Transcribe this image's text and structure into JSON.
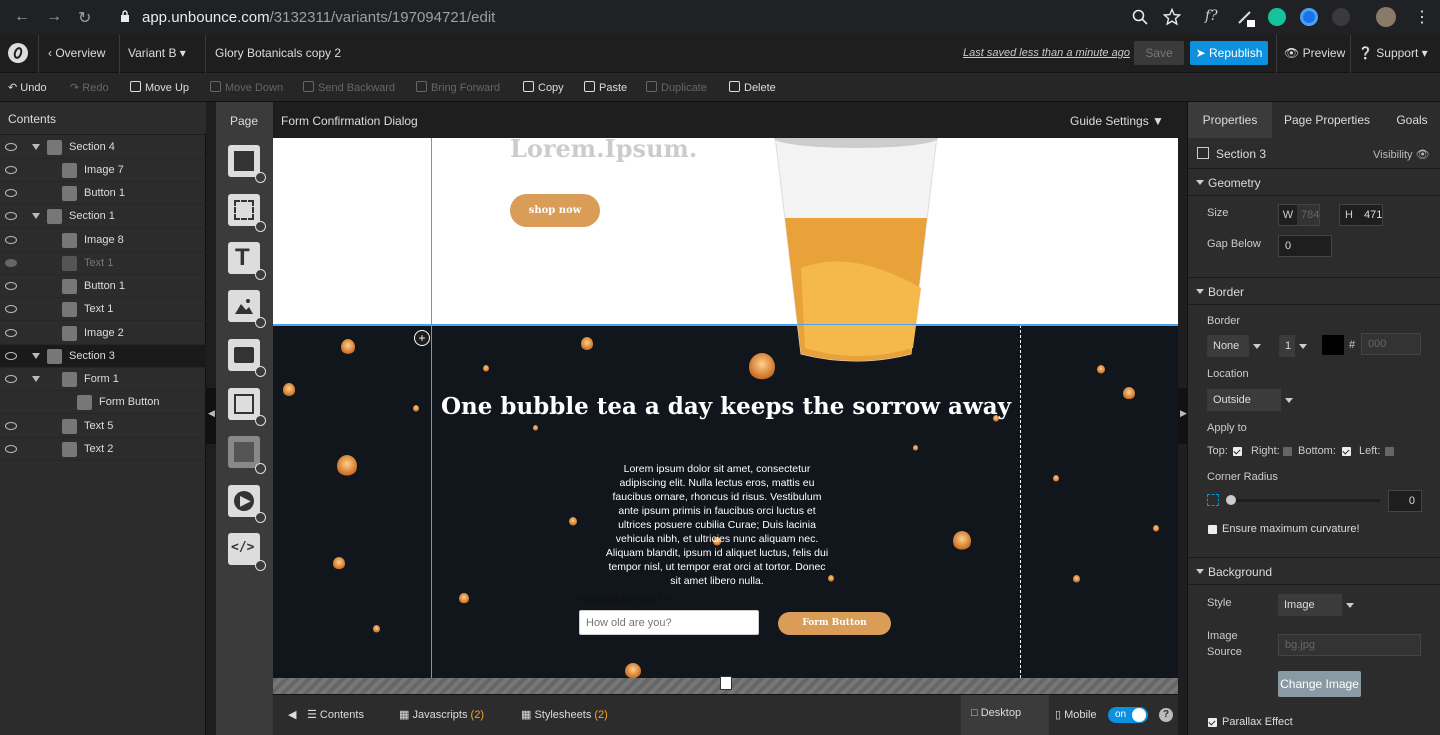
{
  "browser": {
    "url_host": "app.unbounce.com",
    "url_path": "/3132311/variants/197094721/edit"
  },
  "header": {
    "overview_label": "Overview",
    "variant_label": "Variant B",
    "page_name": "Glory Botanicals copy 2",
    "last_saved": "Last saved  less than a minute ago",
    "save_label": "Save",
    "republish_label": "Republish",
    "preview_label": "Preview",
    "support_label": "Support"
  },
  "toolbar": {
    "undo": "Undo",
    "redo": "Redo",
    "move_up": "Move Up",
    "move_down": "Move Down",
    "send_backward": "Send Backward",
    "bring_forward": "Bring Forward",
    "copy": "Copy",
    "paste": "Paste",
    "duplicate": "Duplicate",
    "delete": "Delete"
  },
  "contents": {
    "title": "Contents",
    "items": [
      {
        "label": "Section 4",
        "level": 0
      },
      {
        "label": "Image 7",
        "level": 1
      },
      {
        "label": "Button 1",
        "level": 1
      },
      {
        "label": "Section 1",
        "level": 0
      },
      {
        "label": "Image 8",
        "level": 1
      },
      {
        "label": "Text 1",
        "level": 1
      },
      {
        "label": "Button 1",
        "level": 1
      },
      {
        "label": "Text 1",
        "level": 1
      },
      {
        "label": "Image 2",
        "level": 1
      },
      {
        "label": "Section 3",
        "level": 0
      },
      {
        "label": "Form 1",
        "level": 1
      },
      {
        "label": "Form Button",
        "level": 2
      },
      {
        "label": "Text 5",
        "level": 1
      },
      {
        "label": "Text 2",
        "level": 1
      }
    ]
  },
  "canvas": {
    "page_tab": "Page",
    "dialog_label": "Form Confirmation Dialog",
    "guide_settings": "Guide Settings",
    "hero_title": "Lorem.Ipsum.",
    "shop_button": "shop now",
    "headline": "One bubble tea a day keeps the sorrow away",
    "body_text": "Lorem ipsum dolor sit amet, consectetur adipiscing elit. Nulla lectus eros, mattis eu faucibus ornare, rhoncus id risus. Vestibulum ante ipsum primis in faucibus orci luctus et ultrices posuere cubilia Curae; Duis lacinia vehicula nibh, et ultricies nunc aliquam nec. Aliquam blandit, ipsum id aliquet luctus, felis dui tempor nisl, ut tempor erat orci at tortor. Donec sit amet libero nulla.",
    "form_label": "How old are you? *",
    "form_placeholder": "How old are you?",
    "form_button": "Form Button"
  },
  "bottombar": {
    "contents": "Contents",
    "javascripts": "Javascripts",
    "javascripts_count": "(2)",
    "stylesheets": "Stylesheets",
    "stylesheets_count": "(2)",
    "desktop": "Desktop",
    "mobile": "Mobile",
    "toggle": "on"
  },
  "properties": {
    "tabs": [
      "Properties",
      "Page Properties",
      "Goals"
    ],
    "element_name": "Section 3",
    "visibility": "Visibility",
    "geometry": {
      "title": "Geometry",
      "size_label": "Size",
      "w_label": "W",
      "w_value": "784",
      "h_label": "H",
      "h_value": "471",
      "gap_label": "Gap Below",
      "gap_value": "0"
    },
    "border": {
      "title": "Border",
      "border_label": "Border",
      "style_value": "None",
      "width_value": "1",
      "hash": "#",
      "color_placeholder": "000",
      "location_label": "Location",
      "location_value": "Outside",
      "apply_label": "Apply to",
      "top": "Top:",
      "right": "Right:",
      "bottom": "Bottom:",
      "left": "Left:",
      "radius_label": "Corner Radius",
      "radius_value": "0",
      "max_curvature": "Ensure maximum curvature!"
    },
    "background": {
      "title": "Background",
      "style_label": "Style",
      "style_value": "Image",
      "source_label": "Image Source",
      "source_value": "bg.jpg",
      "change_button": "Change Image",
      "parallax": "Parallax Effect"
    }
  }
}
